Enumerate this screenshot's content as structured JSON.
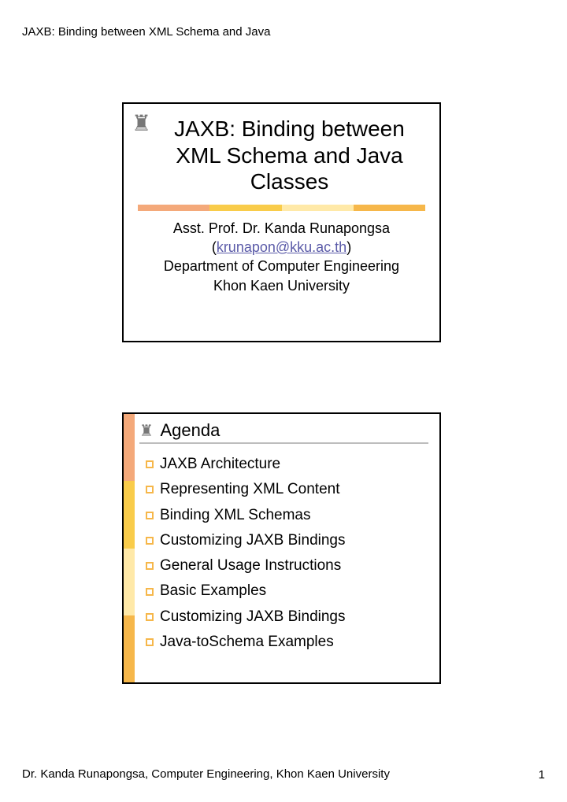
{
  "header": "JAXB: Binding between XML Schema and Java",
  "slide1": {
    "title": "JAXB: Binding between XML Schema and Java Classes",
    "author_line": "Asst. Prof. Dr. Kanda Runapongsa",
    "email": "krunapon@kku.ac.th",
    "dept": "Department of Computer Engineering",
    "university": "Khon Kaen University"
  },
  "slide2": {
    "title": "Agenda",
    "items": [
      "JAXB Architecture",
      "Representing XML Content",
      "Binding XML Schemas",
      "Customizing JAXB Bindings",
      "General Usage Instructions",
      "Basic Examples",
      "Customizing JAXB Bindings",
      "Java-toSchema Examples"
    ]
  },
  "footer": {
    "left": "Dr. Kanda Runapongsa, Computer Engineering, Khon Kaen University",
    "page": "1"
  }
}
